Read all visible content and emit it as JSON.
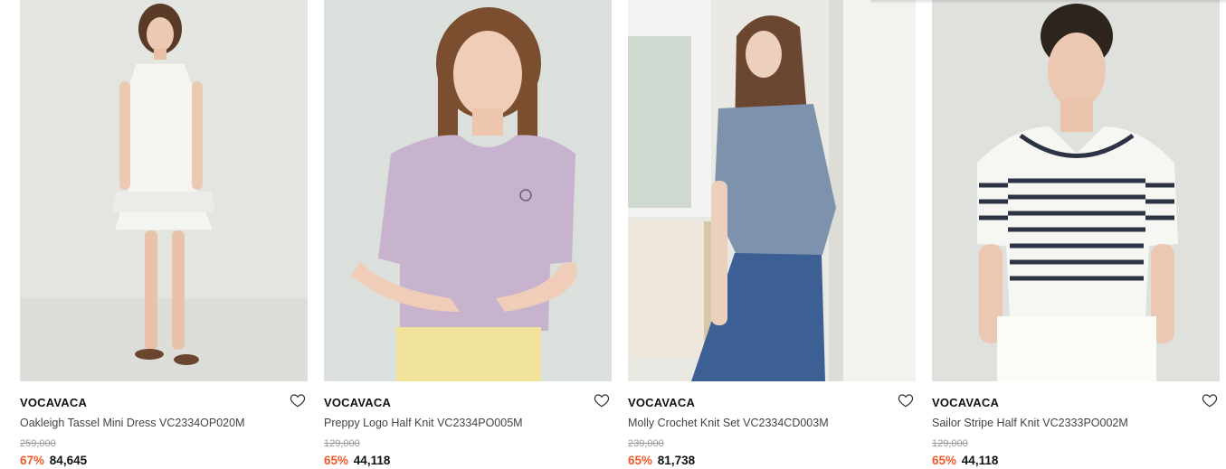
{
  "products": [
    {
      "brand": "VOCAVACA",
      "name": "Oakleigh Tassel Mini Dress VC2334OP020M",
      "original_price": "259,000",
      "discount": "67%",
      "price": "84,645",
      "photo_bg": "#e3e5e0",
      "garment_color": "#f4f4f1"
    },
    {
      "brand": "VOCAVACA",
      "name": "Preppy Logo Half Knit VC2334PO005M",
      "original_price": "129,000",
      "discount": "65%",
      "price": "44,118",
      "photo_bg": "#dbe0dc",
      "garment_color": "#c7b3ce"
    },
    {
      "brand": "VOCAVACA",
      "name": "Molly Crochet Knit Set VC2334CD003M",
      "original_price": "239,000",
      "discount": "65%",
      "price": "81,738",
      "photo_bg": "#e9e8e2",
      "garment_color": "#7d93ad"
    },
    {
      "brand": "VOCAVACA",
      "name": "Sailor Stripe Half Knit VC2333PO002M",
      "original_price": "129,000",
      "discount": "65%",
      "price": "44,118",
      "photo_bg": "#dfe1dd",
      "garment_color": "#f6f6f2"
    }
  ],
  "icons": {
    "wishlist": "heart-outline-icon"
  },
  "colors": {
    "discount": "#f05a28",
    "brand_text": "#111111",
    "strike_price": "#999999"
  }
}
